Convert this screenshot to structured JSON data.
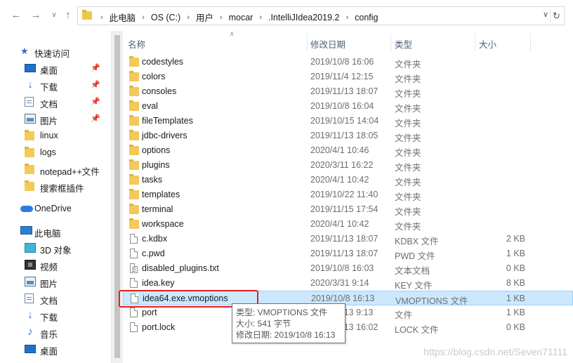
{
  "address_bar": {
    "crumbs": [
      "此电脑",
      "OS (C:)",
      "用户",
      "mocar",
      ".IntelliJIdea2019.2",
      "config"
    ]
  },
  "nav": {
    "quick_access": "快速访问",
    "pinned": [
      {
        "label": "桌面",
        "icon": "desktop-icon"
      },
      {
        "label": "下载",
        "icon": "download-icon"
      },
      {
        "label": "文档",
        "icon": "document-icon"
      },
      {
        "label": "图片",
        "icon": "picture-icon"
      }
    ],
    "recent": [
      "linux",
      "logs",
      "notepad++文件",
      "搜索框插件"
    ],
    "onedrive": "OneDrive",
    "this_pc": "此电脑",
    "pc_items": [
      {
        "label": "3D 对象",
        "icon": "3d-objects-icon"
      },
      {
        "label": "视频",
        "icon": "video-icon"
      },
      {
        "label": "图片",
        "icon": "picture-icon"
      },
      {
        "label": "文档",
        "icon": "document-icon"
      },
      {
        "label": "下载",
        "icon": "download-icon"
      },
      {
        "label": "音乐",
        "icon": "music-icon"
      },
      {
        "label": "桌面",
        "icon": "desktop-icon"
      }
    ]
  },
  "columns": {
    "name": "名称",
    "date": "修改日期",
    "type": "类型",
    "size": "大小"
  },
  "files": [
    {
      "name": "codestyles",
      "date": "2019/10/8 16:06",
      "type": "文件夹",
      "size": "",
      "kind": "folder"
    },
    {
      "name": "colors",
      "date": "2019/11/4 12:15",
      "type": "文件夹",
      "size": "",
      "kind": "folder"
    },
    {
      "name": "consoles",
      "date": "2019/11/13 18:07",
      "type": "文件夹",
      "size": "",
      "kind": "folder"
    },
    {
      "name": "eval",
      "date": "2019/10/8 16:04",
      "type": "文件夹",
      "size": "",
      "kind": "folder"
    },
    {
      "name": "fileTemplates",
      "date": "2019/10/15 14:04",
      "type": "文件夹",
      "size": "",
      "kind": "folder"
    },
    {
      "name": "jdbc-drivers",
      "date": "2019/11/13 18:05",
      "type": "文件夹",
      "size": "",
      "kind": "folder"
    },
    {
      "name": "options",
      "date": "2020/4/1 10:46",
      "type": "文件夹",
      "size": "",
      "kind": "folder"
    },
    {
      "name": "plugins",
      "date": "2020/3/11 16:22",
      "type": "文件夹",
      "size": "",
      "kind": "folder"
    },
    {
      "name": "tasks",
      "date": "2020/4/1 10:42",
      "type": "文件夹",
      "size": "",
      "kind": "folder"
    },
    {
      "name": "templates",
      "date": "2019/10/22 11:40",
      "type": "文件夹",
      "size": "",
      "kind": "folder"
    },
    {
      "name": "terminal",
      "date": "2019/11/15 17:54",
      "type": "文件夹",
      "size": "",
      "kind": "folder"
    },
    {
      "name": "workspace",
      "date": "2020/4/1 10:42",
      "type": "文件夹",
      "size": "",
      "kind": "folder"
    },
    {
      "name": "c.kdbx",
      "date": "2019/11/13 18:07",
      "type": "KDBX 文件",
      "size": "2 KB",
      "kind": "file"
    },
    {
      "name": "c.pwd",
      "date": "2019/11/13 18:07",
      "type": "PWD 文件",
      "size": "1 KB",
      "kind": "file"
    },
    {
      "name": "disabled_plugins.txt",
      "date": "2019/10/8 16:03",
      "type": "文本文档",
      "size": "0 KB",
      "kind": "text"
    },
    {
      "name": "idea.key",
      "date": "2020/3/31 9:14",
      "type": "KEY 文件",
      "size": "8 KB",
      "kind": "file"
    },
    {
      "name": "idea64.exe.vmoptions",
      "date": "2019/10/8 16:13",
      "type": "VMOPTIONS 文件",
      "size": "1 KB",
      "kind": "file",
      "selected": true
    },
    {
      "name": "port",
      "date": "2019/11/13 9:13",
      "type": "文件",
      "size": "1 KB",
      "kind": "file"
    },
    {
      "name": "port.lock",
      "date": "2019/11/13 16:02",
      "type": "LOCK 文件",
      "size": "0 KB",
      "kind": "file"
    }
  ],
  "tooltip": {
    "type_line": "类型: VMOPTIONS 文件",
    "size_line": "大小: 541 字节",
    "date_line": "修改日期: 2019/10/8 16:13"
  },
  "watermark": "https://blog.csdn.net/Seven71111",
  "colors": {
    "selection": "#cce8ff",
    "highlight_box": "#e02020",
    "folder": "#f3c95a"
  }
}
